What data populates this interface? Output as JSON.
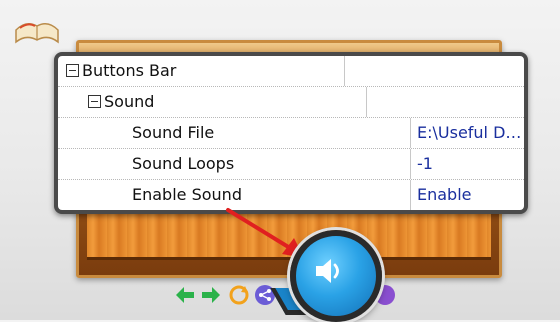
{
  "panel": {
    "rows": [
      {
        "name": "Buttons Bar",
        "value": ""
      },
      {
        "name": "Sound",
        "value": ""
      },
      {
        "name": "Sound File",
        "value": "E:\\Useful Docum..."
      },
      {
        "name": "Sound Loops",
        "value": "-1"
      },
      {
        "name": "Enable Sound",
        "value": "Enable"
      }
    ]
  },
  "icons": {
    "book": "book-icon",
    "speaker": "speaker-icon",
    "arrow": "red-arrow",
    "toolbar": [
      "arrow-left-icon",
      "arrow-right-icon",
      "refresh-icon",
      "share-icon",
      "help-icon"
    ]
  },
  "colors": {
    "value_text": "#1a2f9e",
    "speaker_blue": "#2aa2e6",
    "arrow_red": "#e02020",
    "shelf_wood": "#e0862a"
  }
}
